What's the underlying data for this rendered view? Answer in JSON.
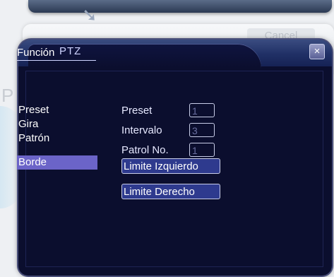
{
  "background": {
    "cancel_label": "Cancel",
    "arrow_icon": "down-arrow-icon",
    "faint_letter": "P"
  },
  "dialog": {
    "title": "PTZ",
    "close_icon": "close-icon",
    "close_glyph": "×"
  },
  "menu": {
    "header": "Función",
    "items": [
      {
        "label": "Preset"
      },
      {
        "label": "Gira"
      },
      {
        "label": "Patrón"
      },
      {
        "label": "Borde",
        "selected": true
      }
    ]
  },
  "form": {
    "preset": {
      "label": "Preset",
      "value": "1"
    },
    "intervalo": {
      "label": "Intervalo",
      "value": "3"
    },
    "patrol": {
      "label": "Patrol No.",
      "value": "1"
    }
  },
  "buttons": {
    "limite_izquierdo": "Limite Izquierdo",
    "limite_derecho": "Limite Derecho"
  },
  "colors": {
    "dialog_bg": "#0b0e2e",
    "header": "#203066",
    "selected": "#6b64c8",
    "button": "#2e3a8e"
  }
}
